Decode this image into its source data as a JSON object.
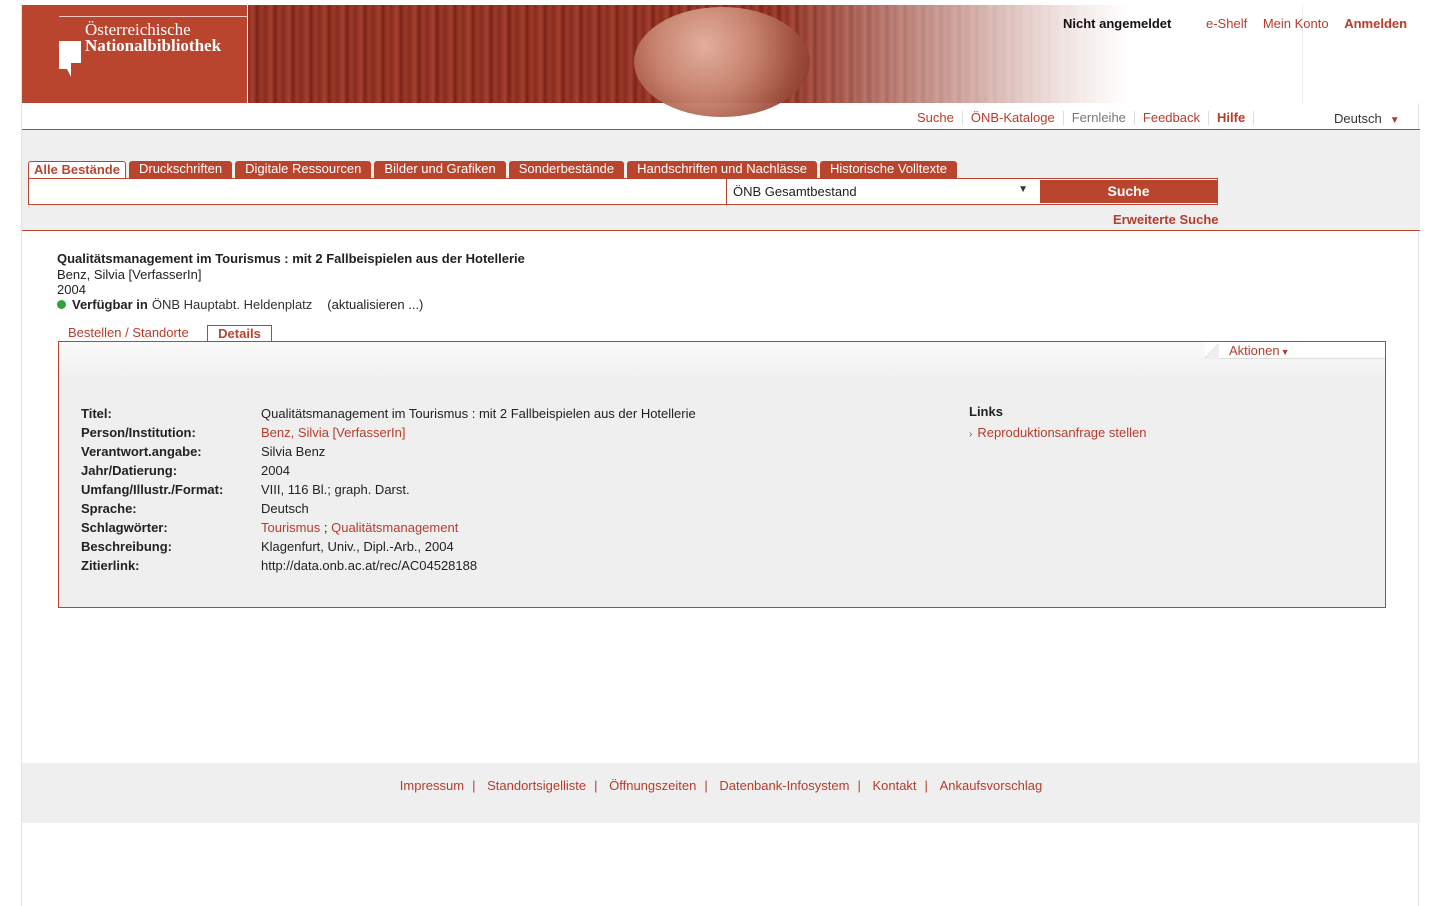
{
  "header": {
    "logo_line1": "Österreichische",
    "logo_line2": "Nationalbibliothek",
    "login_status": "Nicht angemeldet",
    "top_links": {
      "eshelf": "e-Shelf",
      "account": "Mein Konto",
      "login": "Anmelden"
    }
  },
  "nav": {
    "search": "Suche",
    "catalogs": "ÖNB-Kataloge",
    "interlibrary": "Fernleihe",
    "feedback": "Feedback",
    "help": "Hilfe",
    "language": "Deutsch"
  },
  "search": {
    "tabs": [
      "Alle Bestände",
      "Druckschriften",
      "Digitale Ressourcen",
      "Bilder und Grafiken",
      "Sonderbestände",
      "Handschriften und Nachlässe",
      "Historische Volltexte"
    ],
    "active_tab_index": 0,
    "query": "",
    "scope": "ÖNB Gesamtbestand",
    "button": "Suche",
    "advanced": "Erweiterte Suche"
  },
  "record": {
    "title": "Qualitätsmanagement im Tourismus : mit 2 Fallbeispielen aus der Hotellerie",
    "author": "Benz, Silvia [VerfasserIn]",
    "year": "2004",
    "availability_label": "Verfügbar in",
    "availability_location": "ÖNB Hauptabt. Heldenplatz",
    "refresh": "(aktualisieren ...)",
    "availability_color": "#2fa33a"
  },
  "detail_tabs": {
    "orders": "Bestellen / Standorte",
    "details": "Details"
  },
  "actions_label": "Aktionen",
  "details": {
    "title_label": "Titel:",
    "title_value": "Qualitätsmanagement im Tourismus : mit 2 Fallbeispielen aus der Hotellerie",
    "person_label": "Person/Institution:",
    "person_value": "Benz, Silvia [VerfasserIn]",
    "resp_label": "Verantwort.angabe:",
    "resp_value": "Silvia Benz",
    "year_label": "Jahr/Datierung:",
    "year_value": "2004",
    "extent_label": "Umfang/Illustr./Format:",
    "extent_value": "VIII, 116 Bl.; graph. Darst.",
    "lang_label": "Sprache:",
    "lang_value": "Deutsch",
    "subjects_label": "Schlagwörter:",
    "subject1": "Tourismus",
    "subject_sep": ";",
    "subject2": "Qualitätsmanagement",
    "desc_label": "Beschreibung:",
    "desc_value": "Klagenfurt, Univ., Dipl.-Arb., 2004",
    "cite_label": "Zitierlink:",
    "cite_value": "http://data.onb.ac.at/rec/AC04528188"
  },
  "links": {
    "heading": "Links",
    "reproduction": "Reproduktionsanfrage stellen"
  },
  "footer": {
    "links": [
      "Impressum",
      "Standortsigelliste",
      "Öffnungszeiten",
      "Datenbank-Infosystem",
      "Kontakt",
      "Ankaufsvorschlag"
    ],
    "separator": "|"
  },
  "colors": {
    "brand": "#b9452f",
    "link": "#b73c2c",
    "panel_bg": "#efefef"
  }
}
